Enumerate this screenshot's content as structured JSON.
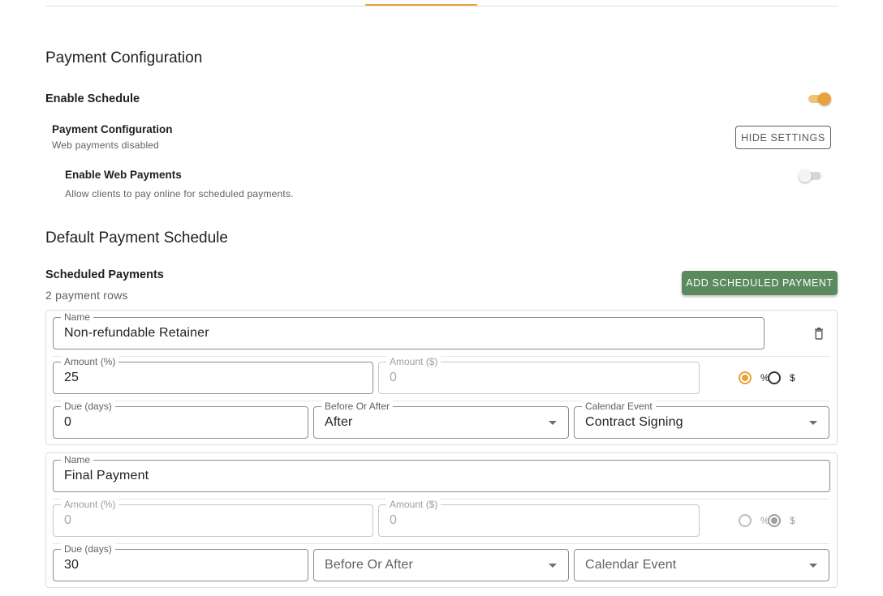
{
  "header": {
    "section_title": "Payment Configuration"
  },
  "enable_schedule": {
    "label": "Enable Schedule",
    "enabled": true
  },
  "payment_config": {
    "title": "Payment Configuration",
    "subtitle": "Web payments disabled",
    "toggle_button": "HIDE SETTINGS"
  },
  "web_payments": {
    "title": "Enable Web Payments",
    "description": "Allow clients to pay online for scheduled payments.",
    "enabled": false
  },
  "schedule": {
    "title": "Default Payment Schedule",
    "subtitle": "Scheduled Payments",
    "row_count": "2 payment rows",
    "add_button": "ADD SCHEDULED PAYMENT"
  },
  "labels": {
    "name": "Name",
    "amount_pct": "Amount (%)",
    "amount_dollar": "Amount ($)",
    "due_days": "Due (days)",
    "before_after": "Before Or After",
    "calendar_event": "Calendar Event",
    "pct_symbol": "%",
    "dollar_symbol": "$"
  },
  "payments": [
    {
      "name": "Non-refundable Retainer",
      "amount_pct": "25",
      "amount_dollar": "0",
      "mode": "%",
      "due_days": "0",
      "before_after": "After",
      "calendar_event": "Contract Signing"
    },
    {
      "name": "Final Payment",
      "amount_pct": "0",
      "amount_dollar": "0",
      "mode": "$",
      "due_days": "30",
      "before_after": "Before Or After",
      "calendar_event": "Calendar Event"
    }
  ],
  "colors": {
    "accent": "#e9a23b",
    "button_green": "#5b8a5f"
  }
}
